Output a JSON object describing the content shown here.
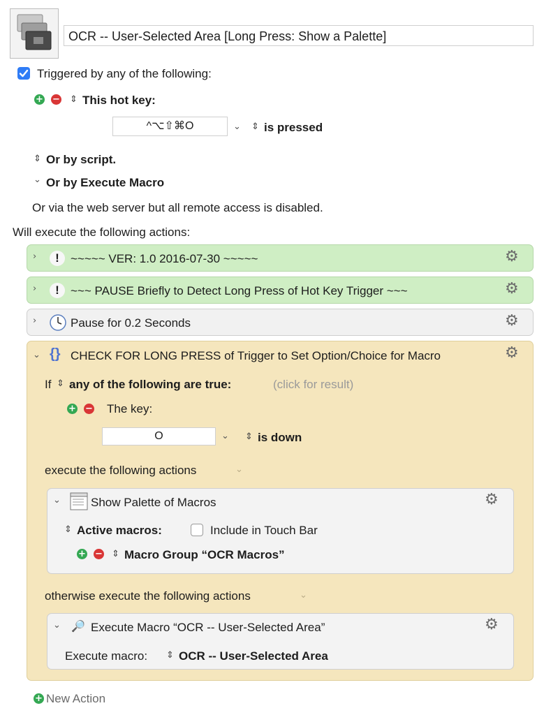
{
  "macro": {
    "title": "OCR -- User-Selected Area [Long Press: Show a Palette]"
  },
  "triggers": {
    "header": "Triggered by any of the following:",
    "hotkey_label": "This hot key:",
    "hotkey_value": "^⌥⇧⌘O",
    "hotkey_state": "is pressed",
    "script_label": "Or by script.",
    "execute_macro_label": "Or by Execute Macro",
    "web_server_text": "Or via the web server but all remote access is disabled."
  },
  "actions_header": "Will execute the following actions:",
  "actions": {
    "a1_title": "~~~~~ VER: 1.0     2016-07-30 ~~~~~",
    "a2_title": "~~~ PAUSE Briefly to Detect Long Press of Hot Key Trigger ~~~",
    "a3_title": "Pause for 0.2 Seconds",
    "a4_title": "CHECK FOR LONG PRESS of Trigger to Set Option/Choice for Macro",
    "if_label": "If",
    "condition_mode": "any of the following are true:",
    "click_result": "(click for result)",
    "condition_key_label": "The key:",
    "condition_key_value": "O",
    "condition_key_state": "is down",
    "then_label": "execute the following actions",
    "palette_title": "Show Palette of Macros",
    "active_macros_label": "Active macros:",
    "touch_bar_label": "Include in Touch Bar",
    "macro_group": "Macro Group “OCR Macros”",
    "else_label": "otherwise execute the following actions",
    "execute_title": "Execute Macro “OCR -- User-Selected Area”",
    "execute_label": "Execute macro:",
    "execute_value": "OCR -- User-Selected Area"
  },
  "new_action_label": "New Action",
  "icons": {
    "checkbox": "checkbox-checked-icon",
    "plus": "add-icon",
    "minus": "remove-icon",
    "updown": "up-down-chevron-icon",
    "gear": "gear-icon",
    "clock": "clock-icon",
    "magnifier": "magnifier-icon"
  },
  "colors": {
    "comment_green": "#cfeec4",
    "if_block_tan": "#f5e6bd",
    "checkbox_blue": "#2f7cf6",
    "add_green": "#34a853",
    "remove_red": "#d93636"
  }
}
